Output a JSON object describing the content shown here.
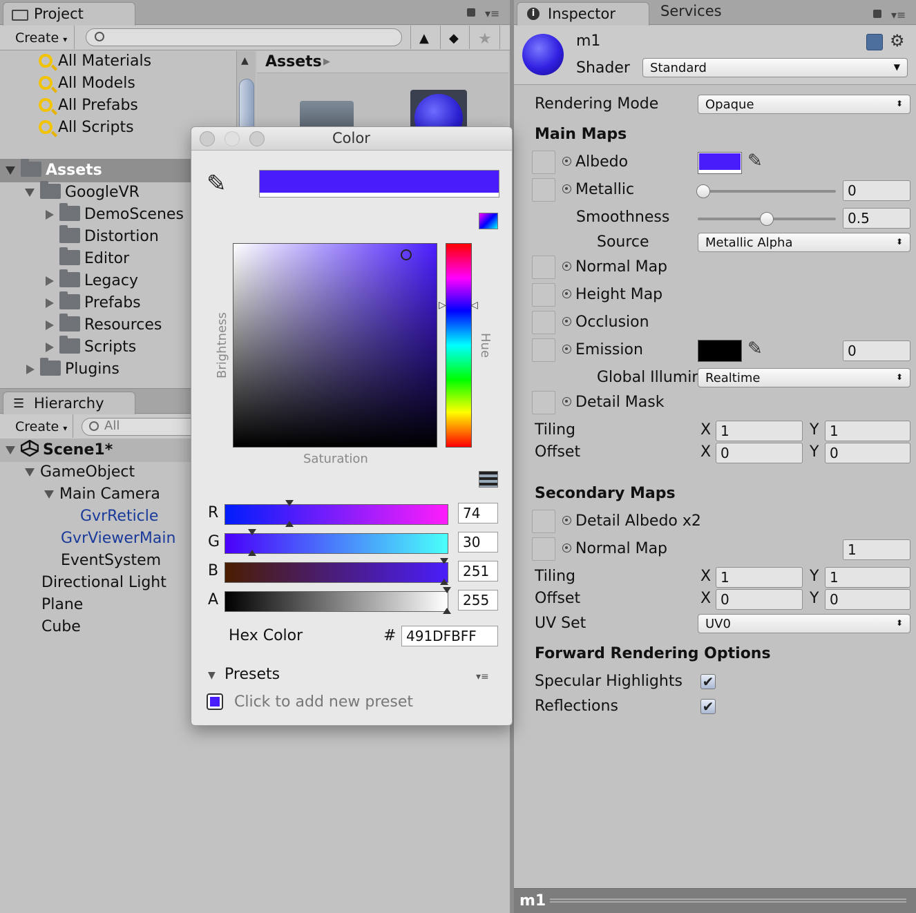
{
  "project": {
    "tab_label": "Project",
    "create_label": "Create",
    "search_placeholder": "",
    "favorites": [
      "All Materials",
      "All Models",
      "All Prefabs",
      "All Scripts"
    ],
    "assets_root": "Assets",
    "tree": {
      "googlevr": "GoogleVR",
      "demoscenes": "DemoScenes",
      "distortion": "Distortion",
      "editor": "Editor",
      "legacy": "Legacy",
      "prefabs": "Prefabs",
      "resources": "Resources",
      "scripts": "Scripts",
      "plugins": "Plugins"
    },
    "breadcrumb": "Assets"
  },
  "hierarchy": {
    "tab_label": "Hierarchy",
    "create_label": "Create",
    "search_placeholder": "All",
    "scene": "Scene1*",
    "items": {
      "gameobject": "GameObject",
      "maincamera": "Main Camera",
      "gvrreticle": "GvrReticle",
      "gvrviewermain": "GvrViewerMain",
      "eventsystem": "EventSystem",
      "directional_light": "Directional Light",
      "plane": "Plane",
      "cube": "Cube"
    }
  },
  "color_dialog": {
    "title": "Color",
    "preview_color": "#491DFB",
    "brightness_label": "Brightness",
    "saturation_label": "Saturation",
    "hue_label": "Hue",
    "r_label": "R",
    "r_value": "74",
    "g_label": "G",
    "g_value": "30",
    "b_label": "B",
    "b_value": "251",
    "a_label": "A",
    "a_value": "255",
    "hex_label": "Hex Color",
    "hex_prefix": "#",
    "hex_value": "491DFBFF",
    "presets_label": "Presets",
    "add_preset": "Click to add new preset"
  },
  "inspector": {
    "tab_label": "Inspector",
    "services_label": "Services",
    "material_name": "m1",
    "shader_label": "Shader",
    "shader_value": "Standard",
    "rendering_mode_label": "Rendering Mode",
    "rendering_mode_value": "Opaque",
    "main_maps": "Main Maps",
    "albedo": "Albedo",
    "albedo_color": "#491DFB",
    "metallic": "Metallic",
    "metallic_value": "0",
    "smoothness": "Smoothness",
    "smoothness_value": "0.5",
    "source": "Source",
    "source_value": "Metallic Alpha",
    "normal_map": "Normal Map",
    "height_map": "Height Map",
    "occlusion": "Occlusion",
    "emission": "Emission",
    "emission_value": "0",
    "global_illum": "Global Illumin",
    "global_illum_value": "Realtime",
    "detail_mask": "Detail Mask",
    "tiling": "Tiling",
    "offset": "Offset",
    "x": "X",
    "y": "Y",
    "tiling_x": "1",
    "tiling_y": "1",
    "offset_x": "0",
    "offset_y": "0",
    "secondary_maps": "Secondary Maps",
    "detail_albedo": "Detail Albedo x2",
    "normal_map2": "Normal Map",
    "normal_map2_value": "1",
    "tiling2_x": "1",
    "tiling2_y": "1",
    "offset2_x": "0",
    "offset2_y": "0",
    "uv_set": "UV Set",
    "uv_set_value": "UV0",
    "forward_rendering": "Forward Rendering Options",
    "specular": "Specular Highlights",
    "reflections": "Reflections",
    "footer_label": "m1"
  }
}
